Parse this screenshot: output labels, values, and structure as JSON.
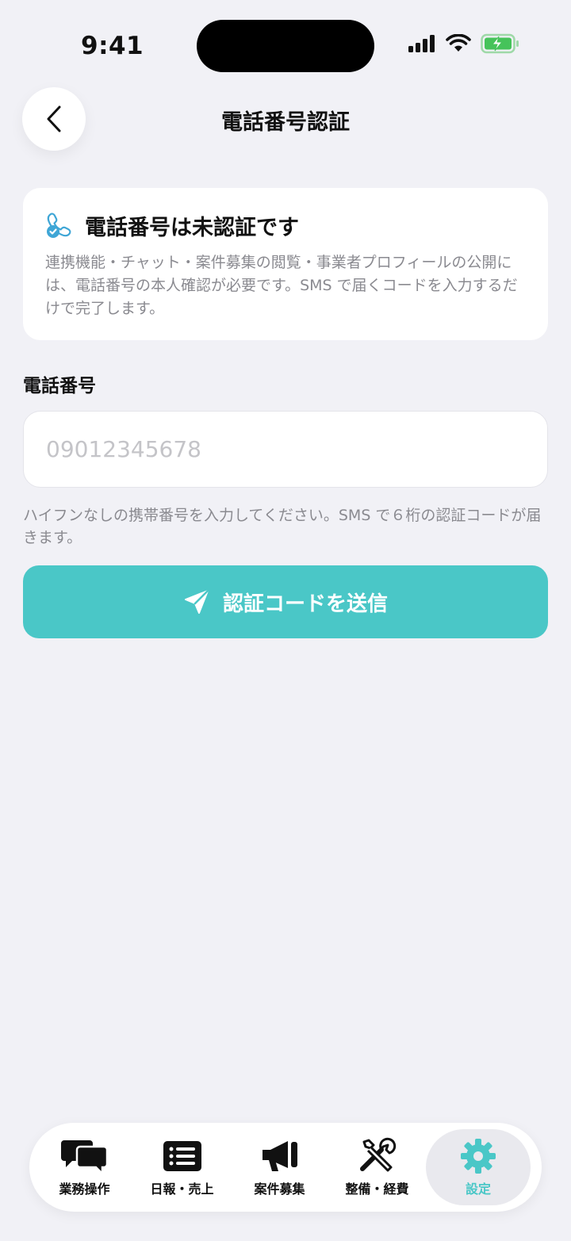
{
  "status_bar": {
    "time": "9:41"
  },
  "header": {
    "title": "電話番号認証"
  },
  "notice": {
    "title": "電話番号は未認証です",
    "body": "連携機能・チャット・案件募集の閲覧・事業者プロフィールの公開には、電話番号の本人確認が必要です。SMS で届くコードを入力するだけで完了します。"
  },
  "form": {
    "phone_label": "電話番号",
    "phone_placeholder": "09012345678",
    "hint": "ハイフンなしの携帯番号を入力してください。SMS で６桁の認証コードが届きます。",
    "send_label": "認証コードを送信"
  },
  "tabbar": {
    "active": "設定",
    "accent_color": "#4ac7c7",
    "items": [
      {
        "label": "業務操作",
        "icon": "chat-bubbles-icon"
      },
      {
        "label": "日報・売上",
        "icon": "list-icon"
      },
      {
        "label": "案件募集",
        "icon": "megaphone-icon"
      },
      {
        "label": "整備・経費",
        "icon": "tools-icon"
      },
      {
        "label": "設定",
        "icon": "gear-icon"
      }
    ]
  }
}
